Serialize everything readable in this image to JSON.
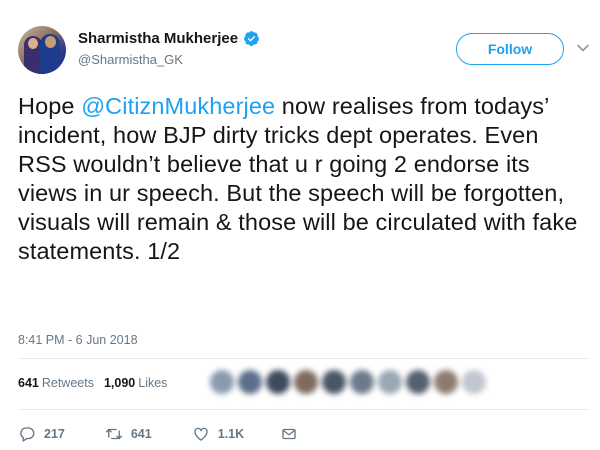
{
  "author": {
    "name": "Sharmistha Mukherjee",
    "handle": "@Sharmistha_GK",
    "verified": true
  },
  "follow_label": "Follow",
  "tweet": {
    "prefix": "Hope ",
    "mention": "@CitiznMukherjee",
    "body": " now realises from todays’ incident, how BJP dirty tricks dept operates. Even RSS wouldn’t believe that u r going 2 endorse its views in ur speech. But the speech will be forgotten, visuals will remain & those will be circulated with fake statements. 1/2"
  },
  "timestamp": "8:41 PM - 6 Jun 2018",
  "stats": {
    "retweets_count": "641",
    "retweets_label": "Retweets",
    "likes_count": "1,090",
    "likes_label": "Likes"
  },
  "actions": {
    "replies": "217",
    "retweets": "641",
    "likes": "1.1K"
  },
  "colors": {
    "accent": "#1da1f2",
    "secondary_text": "#657786"
  },
  "icons": [
    "verified-badge-icon",
    "chevron-down-icon",
    "reply-icon",
    "retweet-icon",
    "like-icon",
    "direct-message-icon"
  ]
}
